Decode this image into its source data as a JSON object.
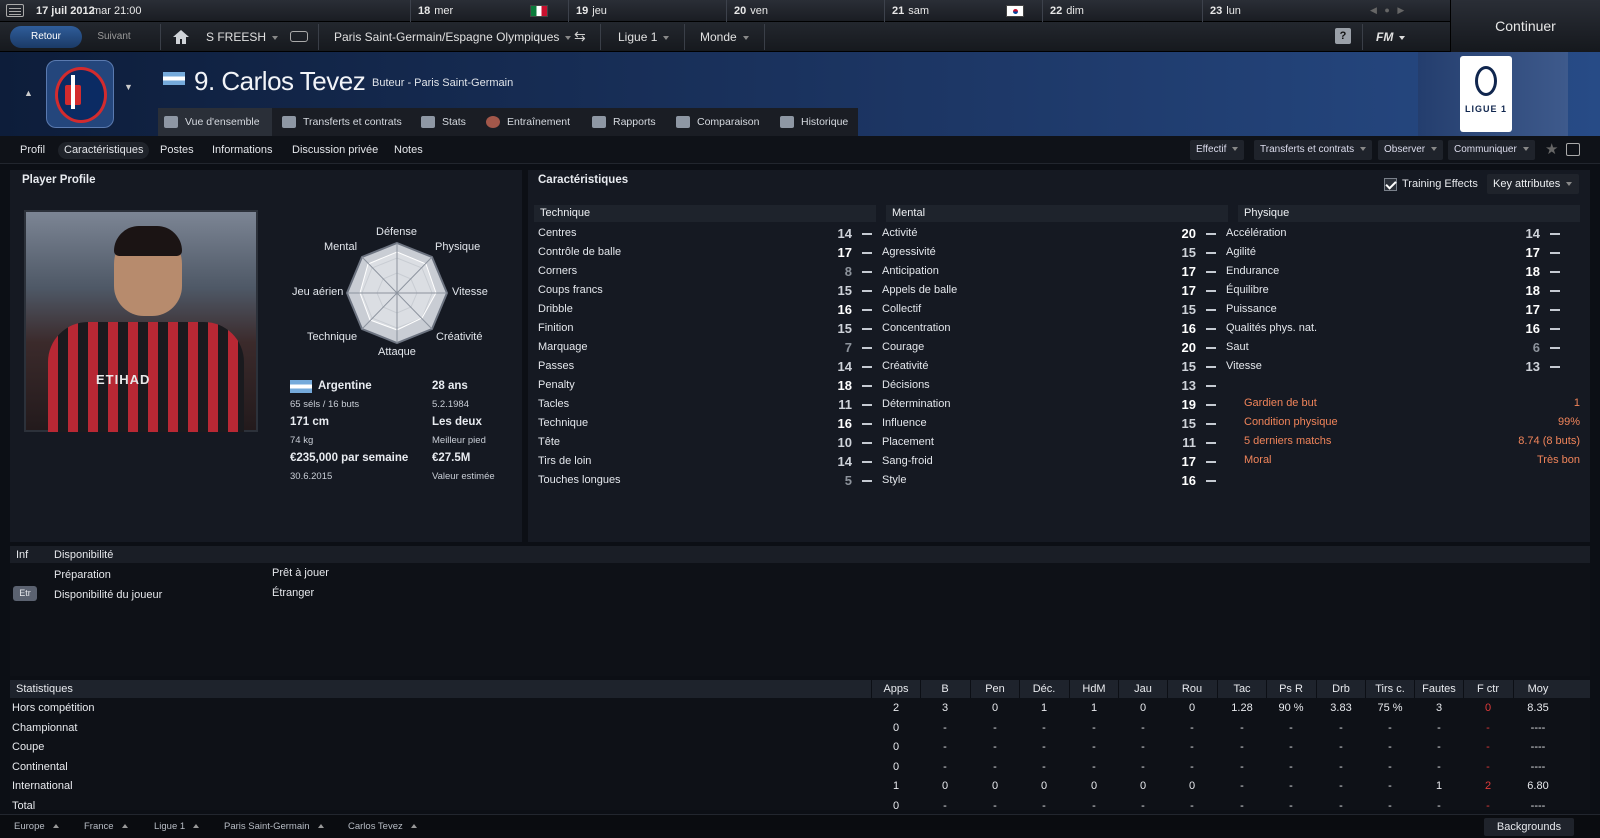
{
  "topbar": {
    "date": "17 juil 2012",
    "day_time": "mar  21:00",
    "days": [
      {
        "num": "18",
        "name": "mer"
      },
      {
        "num": "19",
        "name": "jeu"
      },
      {
        "num": "20",
        "name": "ven"
      },
      {
        "num": "21",
        "name": "sam"
      },
      {
        "num": "22",
        "name": "dim"
      },
      {
        "num": "23",
        "name": "lun"
      }
    ],
    "continue_label": "Continuer"
  },
  "nav": {
    "back": "Retour",
    "next": "Suivant",
    "manager": "S FREESH",
    "club_menu": "Paris Saint-Germain/Espagne Olympiques",
    "league_menu": "Ligue 1",
    "world_menu": "Monde",
    "help": "?",
    "fm": "FM"
  },
  "player": {
    "name": "9. Carlos Tevez",
    "role": "Buteur - Paris Saint-Germain"
  },
  "tabs": [
    "Vue d'ensemble",
    "Transferts et contrats",
    "Stats",
    "Entraînement",
    "Rapports",
    "Comparaison",
    "Historique"
  ],
  "league_logo_text": "LIGUE 1",
  "subnav": {
    "items": [
      "Profil",
      "Caractéristiques",
      "Postes",
      "Informations",
      "Discussion privée",
      "Notes"
    ],
    "dropdowns": [
      "Effectif",
      "Transferts et contrats",
      "Observer",
      "Communiquer"
    ]
  },
  "profile": {
    "title": "Player Profile",
    "shirt_sponsor": "ETIHAD",
    "radar": [
      "Défense",
      "Physique",
      "Vitesse",
      "Créativité",
      "Attaque",
      "Technique",
      "Jeu aérien",
      "Mental"
    ],
    "nation": "Argentine",
    "caps": "65 séls / 16 buts",
    "age": "28 ans",
    "dob": "5.2.1984",
    "height": "171 cm",
    "weight": "74 kg",
    "foot": "Les deux",
    "foot_label": "Meilleur pied",
    "wage": "€235,000 par semaine",
    "contract": "30.6.2015",
    "value": "€27.5M",
    "value_label": "Valeur estimée"
  },
  "attributes": {
    "title": "Caractéristiques",
    "training_effects": "Training Effects",
    "key_attributes": "Key attributes",
    "technique_title": "Technique",
    "mental_title": "Mental",
    "physique_title": "Physique",
    "technique": [
      {
        "n": "Centres",
        "v": "14"
      },
      {
        "n": "Contrôle de balle",
        "v": "17"
      },
      {
        "n": "Corners",
        "v": "8"
      },
      {
        "n": "Coups francs",
        "v": "15"
      },
      {
        "n": "Dribble",
        "v": "16"
      },
      {
        "n": "Finition",
        "v": "15"
      },
      {
        "n": "Marquage",
        "v": "7"
      },
      {
        "n": "Passes",
        "v": "14"
      },
      {
        "n": "Penalty",
        "v": "18"
      },
      {
        "n": "Tacles",
        "v": "11"
      },
      {
        "n": "Technique",
        "v": "16"
      },
      {
        "n": "Tête",
        "v": "10"
      },
      {
        "n": "Tirs de loin",
        "v": "14"
      },
      {
        "n": "Touches longues",
        "v": "5"
      }
    ],
    "mental": [
      {
        "n": "Activité",
        "v": "20"
      },
      {
        "n": "Agressivité",
        "v": "15"
      },
      {
        "n": "Anticipation",
        "v": "17"
      },
      {
        "n": "Appels de balle",
        "v": "17"
      },
      {
        "n": "Collectif",
        "v": "15"
      },
      {
        "n": "Concentration",
        "v": "16"
      },
      {
        "n": "Courage",
        "v": "20"
      },
      {
        "n": "Créativité",
        "v": "15"
      },
      {
        "n": "Décisions",
        "v": "13"
      },
      {
        "n": "Détermination",
        "v": "19"
      },
      {
        "n": "Influence",
        "v": "15"
      },
      {
        "n": "Placement",
        "v": "11"
      },
      {
        "n": "Sang-froid",
        "v": "17"
      },
      {
        "n": "Style",
        "v": "16"
      }
    ],
    "physique": [
      {
        "n": "Accélération",
        "v": "14"
      },
      {
        "n": "Agilité",
        "v": "17"
      },
      {
        "n": "Endurance",
        "v": "18"
      },
      {
        "n": "Équilibre",
        "v": "18"
      },
      {
        "n": "Puissance",
        "v": "17"
      },
      {
        "n": "Qualités phys. nat.",
        "v": "16"
      },
      {
        "n": "Saut",
        "v": "6"
      },
      {
        "n": "Vitesse",
        "v": "13"
      }
    ],
    "extras": [
      {
        "n": "Gardien de but",
        "v": "1"
      },
      {
        "n": "Condition physique",
        "v": "99%"
      },
      {
        "n": "5 derniers matchs",
        "v": "8.74 (8 buts)"
      },
      {
        "n": "Moral",
        "v": "Très bon"
      }
    ]
  },
  "availability": {
    "col_inf": "Inf",
    "col_title": "Disponibilité",
    "prep_label": "Préparation",
    "prep_value": "Prêt à jouer",
    "badge": "Etr",
    "player_label": "Disponibilité du joueur",
    "player_value": "Étranger"
  },
  "stats": {
    "title": "Statistiques",
    "columns": [
      "Apps",
      "B",
      "Pen",
      "Déc.",
      "HdM",
      "Jau",
      "Rou",
      "Tac",
      "Ps R",
      "Drb",
      "Tirs c.",
      "Fautes",
      "F ctr",
      "Moy"
    ],
    "rows": [
      {
        "label": "Hors compétition",
        "cells": [
          "2",
          "3",
          "0",
          "1",
          "1",
          "0",
          "0",
          "1.28",
          "90 %",
          "3.83",
          "75 %",
          "3",
          "0",
          "8.35"
        ]
      },
      {
        "label": "Championnat",
        "cells": [
          "0",
          "-",
          "-",
          "-",
          "-",
          "-",
          "-",
          "-",
          "-",
          "-",
          "-",
          "-",
          "-",
          "----"
        ]
      },
      {
        "label": "Coupe",
        "cells": [
          "0",
          "-",
          "-",
          "-",
          "-",
          "-",
          "-",
          "-",
          "-",
          "-",
          "-",
          "-",
          "-",
          "----"
        ]
      },
      {
        "label": "Continental",
        "cells": [
          "0",
          "-",
          "-",
          "-",
          "-",
          "-",
          "-",
          "-",
          "-",
          "-",
          "-",
          "-",
          "-",
          "----"
        ]
      },
      {
        "label": "International",
        "cells": [
          "1",
          "0",
          "0",
          "0",
          "0",
          "0",
          "0",
          "-",
          "-",
          "-",
          "-",
          "1",
          "2",
          "6.80"
        ]
      },
      {
        "label": "Total",
        "cells": [
          "0",
          "-",
          "-",
          "-",
          "-",
          "-",
          "-",
          "-",
          "-",
          "-",
          "-",
          "-",
          "-",
          "----"
        ]
      }
    ]
  },
  "breadcrumbs": [
    "Europe",
    "France",
    "Ligue 1",
    "Paris Saint-Germain",
    "Carlos Tevez"
  ],
  "backgrounds_label": "Backgrounds",
  "colors": {
    "accent_orange": "#f0845a",
    "back_button": "#2f5d9a",
    "red_value": "#e03a3a"
  }
}
